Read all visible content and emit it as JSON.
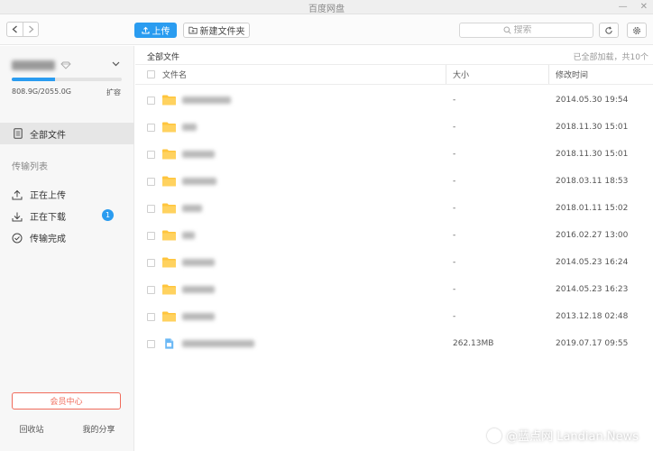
{
  "window": {
    "title": "百度网盘"
  },
  "toolbar": {
    "upload_label": "上传",
    "new_folder_label": "新建文件夹",
    "search_placeholder": "搜索"
  },
  "sidebar": {
    "storage": {
      "text": "808.9G/2055.0G",
      "used_fraction": 0.3936
    },
    "expand_label": "扩容",
    "all_files_label": "全部文件",
    "transfer_section_label": "传输列表",
    "transfer_items": [
      {
        "label": "正在上传",
        "icon": "upload-icon"
      },
      {
        "label": "正在下载",
        "icon": "download-icon",
        "badge": "1"
      },
      {
        "label": "传输完成",
        "icon": "check-circle-icon"
      }
    ],
    "vip_label": "会员中心",
    "recycle_label": "回收站",
    "share_label": "我的分享"
  },
  "main": {
    "breadcrumb": "全部文件",
    "loaded_text": "已全部加载，共10个",
    "columns": {
      "name": "文件名",
      "size": "大小",
      "modified": "修改时间"
    },
    "files": [
      {
        "type": "folder",
        "size": "-",
        "modified": "2014.05.30 19:54"
      },
      {
        "type": "folder",
        "size": "-",
        "modified": "2018.11.30 15:01"
      },
      {
        "type": "folder",
        "size": "-",
        "modified": "2018.11.30 15:01"
      },
      {
        "type": "folder",
        "size": "-",
        "modified": "2018.03.11 18:53"
      },
      {
        "type": "folder",
        "size": "-",
        "modified": "2018.01.11 15:02"
      },
      {
        "type": "folder",
        "size": "-",
        "modified": "2016.02.27 13:00"
      },
      {
        "type": "folder",
        "size": "-",
        "modified": "2014.05.23 16:24"
      },
      {
        "type": "folder",
        "size": "-",
        "modified": "2014.05.23 16:23"
      },
      {
        "type": "folder",
        "size": "-",
        "modified": "2013.12.18 02:48"
      },
      {
        "type": "file",
        "size": "262.13MB",
        "modified": "2019.07.17 09:55"
      }
    ]
  },
  "watermark": {
    "text": "@蓝点网 Landian.News"
  },
  "colors": {
    "accent": "#2a9cf0",
    "folder": "#ffc53d",
    "vip": "#f06b5b"
  }
}
